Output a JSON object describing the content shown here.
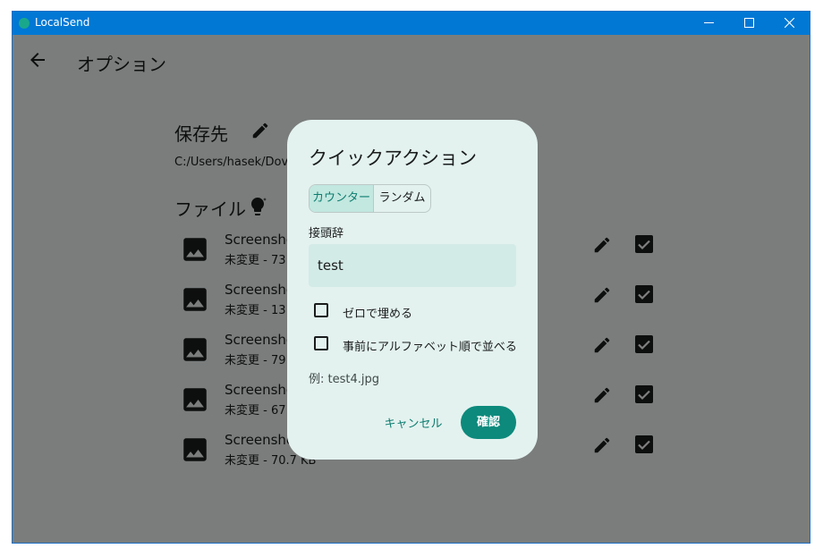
{
  "window": {
    "title": "LocalSend"
  },
  "page": {
    "title": "オプション"
  },
  "destination": {
    "title": "保存先",
    "path": "C:/Users/hasek/Dov"
  },
  "files": {
    "title": "ファイル",
    "items": [
      {
        "name": "Screensho",
        "status": "未変更 - 73"
      },
      {
        "name": "Screensho",
        "status": "未変更 - 13"
      },
      {
        "name": "Screensho",
        "status": "未変更 - 79"
      },
      {
        "name": "Screensho",
        "status": "未変更 - 67"
      },
      {
        "name": "Screensho",
        "status": "未変更 - 70.7 KB"
      }
    ]
  },
  "dialog": {
    "title": "クイックアクション",
    "segments": [
      {
        "label": "カウンター",
        "selected": true
      },
      {
        "label": "ランダム",
        "selected": false
      }
    ],
    "prefix_label": "接頭辞",
    "prefix_value": "test",
    "options": [
      {
        "label": "ゼロで埋める",
        "checked": false
      },
      {
        "label": "事前にアルファベット順で並べる",
        "checked": false
      }
    ],
    "example": "例: test4.jpg",
    "cancel_label": "キャンセル",
    "confirm_label": "確認"
  },
  "colors": {
    "titlebar": "#0078d4",
    "accent": "#0d8a7c",
    "dialog_bg": "#e3f2ef",
    "input_bg": "#d3ebe7",
    "segment_selected": "#c2e8e0"
  }
}
